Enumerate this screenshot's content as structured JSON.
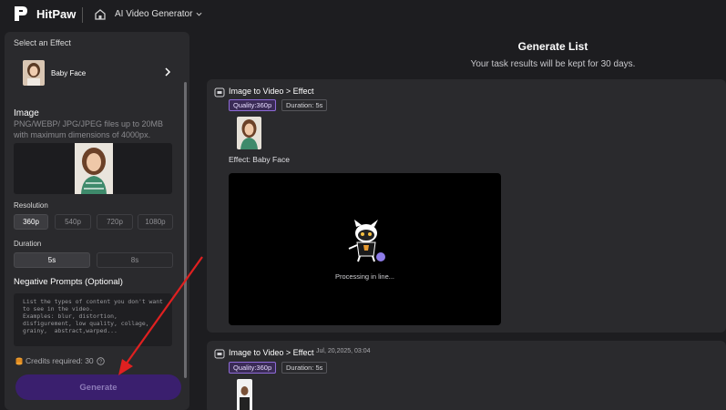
{
  "app": {
    "name": "HitPaw",
    "product": "AI Video Generator"
  },
  "left_panel": {
    "select_effect_label": "Select an Effect",
    "effect_name": "Baby Face",
    "image_title": "Image",
    "image_hint": "PNG/WEBP/ JPG/JPEG files up to 20MB with maximum dimensions of 4000px.",
    "resolution_label": "Resolution",
    "resolutions": [
      "360p",
      "540p",
      "720p",
      "1080p"
    ],
    "selected_resolution": "360p",
    "duration_label": "Duration",
    "durations": [
      "5s",
      "8s"
    ],
    "selected_duration": "5s",
    "negative_title": "Negative Prompts (Optional)",
    "negative_placeholder": "List the types of content you don't want to see in the video.\nExamples: blur, distortion, disfigurement, low quality, collage, grainy,  abstract,warped...",
    "credits_text": "Credits required: 30",
    "generate_label": "Generate"
  },
  "generate_list": {
    "title": "Generate List",
    "subtitle": "Your task results will be kept for 30 days.",
    "tasks": [
      {
        "title": "Image to Video > Effect",
        "date": "",
        "quality": "Quality:360p",
        "duration": "Duration: 5s",
        "effect_line": "Effect: Baby Face",
        "status": "Processing in line..."
      },
      {
        "title": "Image to Video > Effect",
        "date": "Jul, 20,2025, 03:04",
        "quality": "Quality:360p",
        "duration": "Duration: 5s"
      }
    ]
  },
  "colors": {
    "background": "#1d1d20",
    "panel": "#2a2a2d",
    "accent_purple": "#3a1f6e",
    "quality_chip": "#8f6bd8",
    "annotation_arrow": "#e02020"
  },
  "icons": [
    "hitpaw-logo-icon",
    "home-icon",
    "chevron-down-icon",
    "chevron-right-icon",
    "coin-stack-icon",
    "info-icon",
    "task-icon",
    "mascot-cat-icon",
    "red-arrow-annotation"
  ]
}
